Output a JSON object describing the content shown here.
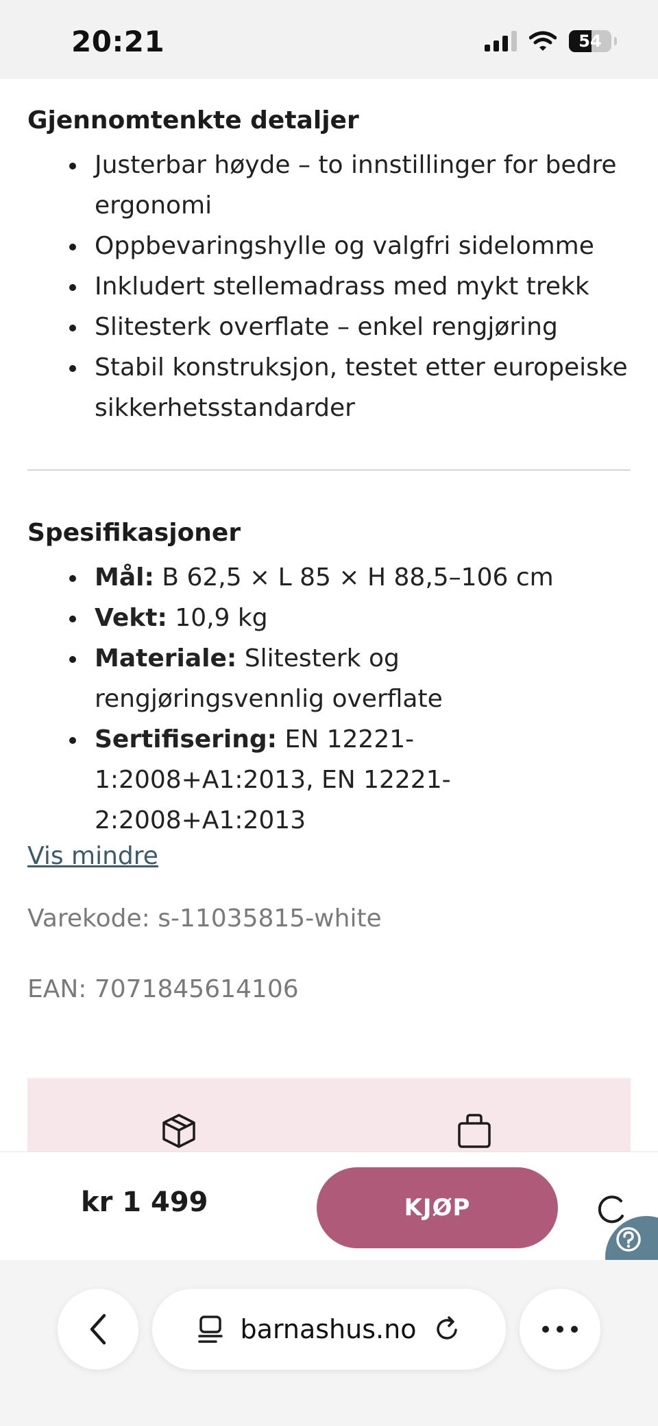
{
  "status_bar": {
    "time": "20:21",
    "battery": "54"
  },
  "details": {
    "title": "Gjennomtenkte detaljer",
    "items": [
      "Justerbar høyde – to innstillinger for bedre ergonomi",
      "Oppbevaringshylle og valgfri sidelomme",
      "Inkludert stellemadrass med mykt trekk",
      "Slitesterk overflate – enkel rengjøring",
      "Stabil konstruksjon, testet etter europeiske sikkerhetsstandarder"
    ]
  },
  "specs": {
    "title": "Spesifikasjoner",
    "items": [
      {
        "label": "Mål:",
        "value": " B 62,5 × L 85 × H 88,5–106 cm"
      },
      {
        "label": "Vekt:",
        "value": " 10,9 kg"
      },
      {
        "label": "Materiale:",
        "value": " Slitesterk og rengjøringsvennlig overflate"
      },
      {
        "label": "Sertifisering:",
        "value": " EN 12221-1:2008+A1:2013, EN 12221-2:2008+A1:2013"
      }
    ]
  },
  "show_less_link": "Vis mindre",
  "product_code": "Varekode: s-11035815-white",
  "ean": "EAN: 7071845614106",
  "purchase": {
    "price": "kr 1 499",
    "buy_label": "KJØP"
  },
  "browser": {
    "url": "barnashus.no"
  },
  "colors": {
    "buy_button": "#b05a79",
    "info_box": "#f8e7ea",
    "link": "#3d5a6a",
    "help_button": "#5e8194"
  },
  "icons": [
    "package-icon",
    "shopping-bag-icon",
    "back-chevron-icon",
    "reader-icon",
    "reload-icon",
    "more-icon",
    "help-icon",
    "loading-spinner-icon"
  ]
}
